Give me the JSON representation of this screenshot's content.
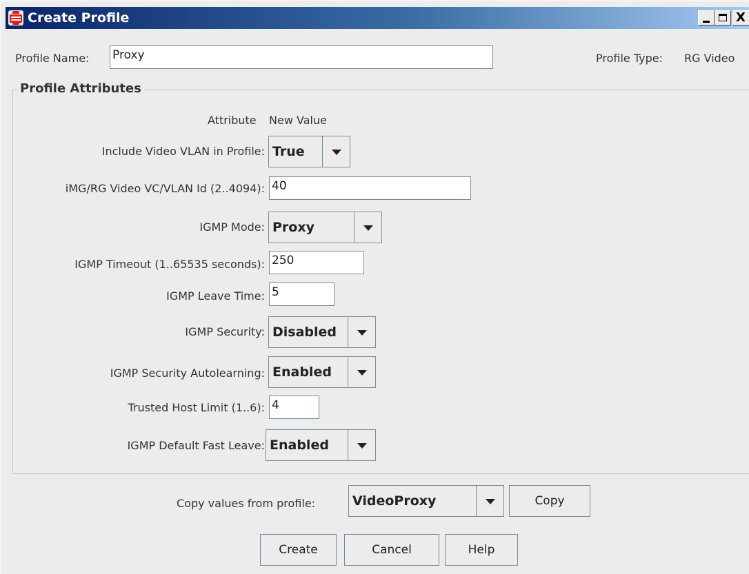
{
  "window": {
    "title": "Create Profile",
    "minimize_glyph": "_",
    "maximize_glyph": "□",
    "close_glyph": "X"
  },
  "header": {
    "profile_name_label": "Profile Name:",
    "profile_name_value": "Proxy",
    "profile_type_label": "Profile Type:",
    "profile_type_value": "RG Video"
  },
  "attributes": {
    "group_title": "Profile Attributes",
    "col_attribute": "Attribute",
    "col_new_value": "New Value",
    "rows": [
      {
        "label": "Include Video VLAN in Profile:",
        "control": "combo",
        "value": "True"
      },
      {
        "label": "iMG/RG Video VC/VLAN Id (2..4094):",
        "control": "text",
        "value": "40"
      },
      {
        "label": "IGMP Mode:",
        "control": "combo",
        "value": "Proxy"
      },
      {
        "label": "IGMP Timeout (1..65535 seconds):",
        "control": "text",
        "value": "250"
      },
      {
        "label": "IGMP Leave Time:",
        "control": "text",
        "value": "5"
      },
      {
        "label": "IGMP Security:",
        "control": "combo",
        "value": "Disabled"
      },
      {
        "label": "IGMP Security Autolearning:",
        "control": "combo",
        "value": "Enabled"
      },
      {
        "label": "Trusted Host Limit (1..6):",
        "control": "text",
        "value": "4"
      },
      {
        "label": "IGMP Default Fast Leave:",
        "control": "combo",
        "value": "Enabled"
      }
    ]
  },
  "copy": {
    "label": "Copy values from profile:",
    "selected": "VideoProxy",
    "button": "Copy"
  },
  "actions": {
    "create": "Create",
    "cancel": "Cancel",
    "help": "Help"
  },
  "icons": {
    "app": "red-server-icon",
    "dropdown": "chevron-down-icon"
  }
}
